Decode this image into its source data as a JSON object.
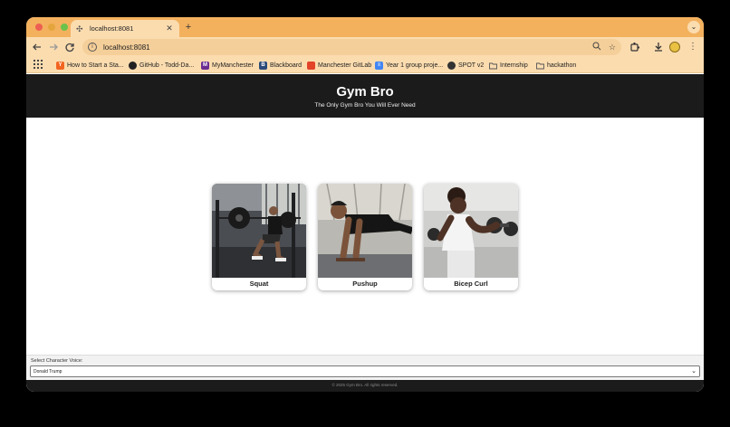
{
  "browser": {
    "tab_title": "localhost:8081",
    "url": "localhost:8081",
    "bookmarks": [
      {
        "label": "How to Start a Sta...",
        "icon": "y-combinator-icon",
        "color": "#f26522"
      },
      {
        "label": "GitHub - Todd-Da...",
        "icon": "github-icon",
        "color": "#222222"
      },
      {
        "label": "MyManchester",
        "icon": "manchester-icon",
        "color": "#6b2c91"
      },
      {
        "label": "Blackboard",
        "icon": "blackboard-icon",
        "color": "#2b4a7a"
      },
      {
        "label": "Manchester GitLab",
        "icon": "gitlab-icon",
        "color": "#e24329"
      },
      {
        "label": "Year 1 group proje...",
        "icon": "docs-icon",
        "color": "#4285f4"
      },
      {
        "label": "SPOT v2",
        "icon": "globe-icon",
        "color": "#333333"
      },
      {
        "label": "Internship",
        "icon": "folder-icon",
        "color": "#555555"
      },
      {
        "label": "hackathon",
        "icon": "folder-icon",
        "color": "#555555"
      }
    ]
  },
  "site": {
    "title": "Gym Bro",
    "subtitle": "The Only Gym Bro You Will Ever Need",
    "exercises": [
      {
        "label": "Squat"
      },
      {
        "label": "Pushup"
      },
      {
        "label": "Bicep Curl"
      }
    ],
    "voice": {
      "label": "Select Character Voice:",
      "selected": "Donald Trump"
    },
    "footer": "© 2025 Gym Bro. All rights reserved."
  },
  "colors": {
    "tab_strip": "#f3b15e",
    "toolbar": "#fbdcaf",
    "header_bg": "#1b1b1b"
  }
}
